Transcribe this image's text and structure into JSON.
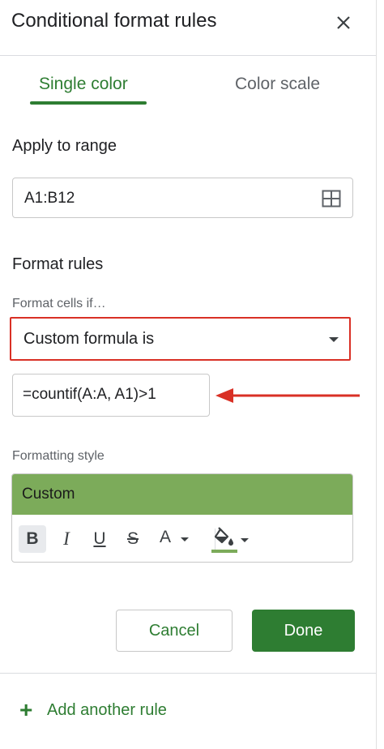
{
  "panel": {
    "title": "Conditional format rules",
    "close_icon": "close-icon"
  },
  "tabs": [
    {
      "label": "Single color",
      "active": true
    },
    {
      "label": "Color scale",
      "active": false
    }
  ],
  "apply_range": {
    "heading": "Apply to range",
    "value": "A1:B12",
    "icon": "grid-select-icon"
  },
  "format_rules": {
    "heading": "Format rules",
    "condition_label": "Format cells if…",
    "condition_value": "Custom formula is",
    "formula_value": "=countif(A:A, A1)>1"
  },
  "formatting_style": {
    "label": "Formatting style",
    "preview_text": "Custom",
    "preview_color": "#7cab5a",
    "toolbar": {
      "bold": "B",
      "italic": "I",
      "underline": "U",
      "strikethrough": "S",
      "text_color": "A",
      "fill_color_icon": "paint-bucket-icon",
      "fill_color": "#7cab5a"
    }
  },
  "actions": {
    "cancel": "Cancel",
    "done": "Done"
  },
  "add_rule": {
    "label": "Add another rule"
  },
  "colors": {
    "accent_green": "#2e7d32",
    "highlight_red": "#d93025"
  }
}
